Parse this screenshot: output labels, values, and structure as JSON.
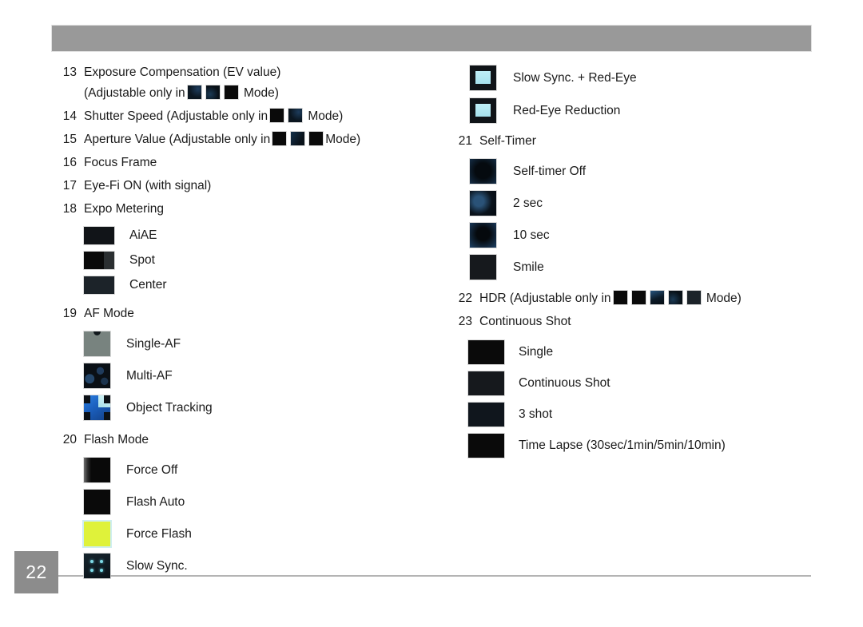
{
  "page": {
    "number": "22",
    "header_accent_color": "#999999",
    "page_box_color": "#8c8c8c"
  },
  "left_column": {
    "entries": [
      {
        "num": "13",
        "line1": "Exposure Compensation (EV value)",
        "line2_before": "(Adjustable only in",
        "line2_after": "Mode)",
        "mode_icons": [
          "mode-icon-navy",
          "mode-icon-navy2",
          "mode-icon-black"
        ]
      },
      {
        "num": "14",
        "line1_before": "Shutter Speed (Adjustable only in",
        "line1_after": "Mode)",
        "mode_icons": [
          "mode-icon-black",
          "mode-icon-navy"
        ]
      },
      {
        "num": "15",
        "line1_before": "Aperture Value (Adjustable only in",
        "line1_after": "Mode)",
        "mode_icons": [
          "mode-icon-black",
          "mode-icon-steel",
          "mode-icon-black"
        ]
      },
      {
        "num": "16",
        "line1": "Focus Frame"
      },
      {
        "num": "17",
        "line1": "Eye-Fi ON (with signal)"
      },
      {
        "num": "18",
        "line1": "Expo Metering"
      }
    ],
    "expo_metering_items": [
      {
        "label": "AiAE",
        "icon": "metering-aiae-icon"
      },
      {
        "label": "Spot",
        "icon": "metering-spot-icon"
      },
      {
        "label": "Center",
        "icon": "metering-center-icon"
      }
    ],
    "af_mode": {
      "num": "19",
      "label": "AF Mode"
    },
    "af_mode_items": [
      {
        "label": "Single-AF",
        "icon": "af-single-icon"
      },
      {
        "label": "Multi-AF",
        "icon": "af-multi-icon"
      },
      {
        "label": "Object Tracking",
        "icon": "af-object-tracking-icon"
      }
    ],
    "flash_mode": {
      "num": "20",
      "label": "Flash Mode"
    },
    "flash_mode_items": [
      {
        "label": "Force Off",
        "icon": "flash-force-off-icon"
      },
      {
        "label": "Flash Auto",
        "icon": "flash-auto-icon"
      },
      {
        "label": "Force Flash",
        "icon": "flash-force-flash-icon"
      },
      {
        "label": "Slow Sync.",
        "icon": "flash-slow-sync-icon"
      }
    ]
  },
  "right_column": {
    "flash_mode_items_cont": [
      {
        "label": "Slow Sync. + Red-Eye",
        "icon": "flash-slow-sync-red-eye-icon"
      },
      {
        "label": "Red-Eye Reduction",
        "icon": "flash-red-eye-reduction-icon"
      }
    ],
    "self_timer": {
      "num": "21",
      "label": "Self-Timer"
    },
    "self_timer_items": [
      {
        "label": "Self-timer Off",
        "icon": "self-timer-off-icon"
      },
      {
        "label": "2 sec",
        "icon": "self-timer-2sec-icon"
      },
      {
        "label": "10 sec",
        "icon": "self-timer-10sec-icon"
      },
      {
        "label": "Smile",
        "icon": "self-timer-smile-icon"
      }
    ],
    "hdr": {
      "num": "22",
      "before": "HDR (Adjustable only in",
      "after": "Mode)",
      "mode_icons": [
        "mode-icon-black",
        "mode-icon-black",
        "mode-icon-blueish",
        "mode-icon-navy2",
        "mode-icon-dark"
      ]
    },
    "continuous_shot": {
      "num": "23",
      "label": "Continuous Shot"
    },
    "continuous_shot_items": [
      {
        "label": "Single",
        "icon": "burst-single-icon"
      },
      {
        "label": "Continuous Shot",
        "icon": "burst-continuous-icon"
      },
      {
        "label": "3 shot",
        "icon": "burst-3shot-icon"
      },
      {
        "label": "Time Lapse (30sec/1min/5min/10min)",
        "icon": "burst-time-lapse-icon"
      }
    ]
  }
}
